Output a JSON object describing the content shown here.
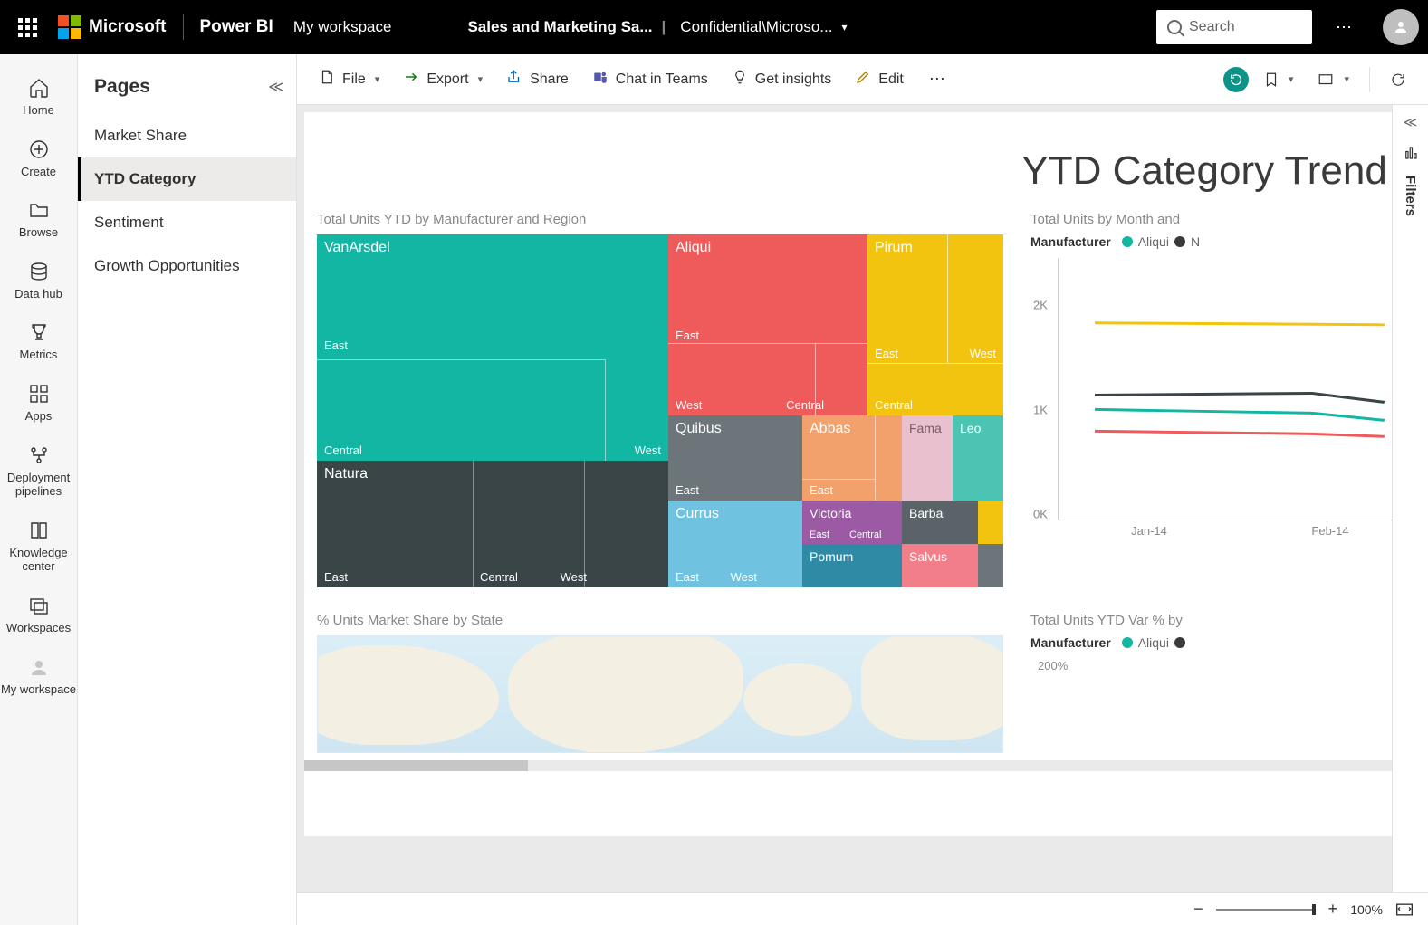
{
  "topbar": {
    "microsoft": "Microsoft",
    "product": "Power BI",
    "workspace": "My workspace",
    "report_name": "Sales and Marketing Sa...",
    "sensitivity": "Confidential\\Microso...",
    "search_placeholder": "Search"
  },
  "rail": {
    "home": "Home",
    "create": "Create",
    "browse": "Browse",
    "datahub": "Data hub",
    "metrics": "Metrics",
    "apps": "Apps",
    "pipelines": "Deployment pipelines",
    "knowledge": "Knowledge center",
    "workspaces": "Workspaces",
    "myworkspace": "My workspace"
  },
  "pages": {
    "header": "Pages",
    "items": [
      "Market Share",
      "YTD Category",
      "Sentiment",
      "Growth Opportunities"
    ],
    "active_index": 1
  },
  "toolbar": {
    "file": "File",
    "export": "Export",
    "share": "Share",
    "teams": "Chat in Teams",
    "insights": "Get insights",
    "edit": "Edit"
  },
  "report": {
    "title": "YTD Category Trend A",
    "treemap_title": "Total Units YTD by Manufacturer and Region",
    "linechart_title": "Total Units by Month and",
    "map_title": "% Units Market Share by State",
    "var_title": "Total Units YTD Var % by",
    "legend_label": "Manufacturer",
    "legend_items": [
      {
        "name": "Aliqui",
        "color": "#13b5a3"
      },
      {
        "name": "N",
        "color": "#3a3a3a"
      }
    ],
    "var_y": "200%"
  },
  "chart_data": {
    "treemap": {
      "type": "treemap",
      "title": "Total Units YTD by Manufacturer and Region",
      "nodes": [
        {
          "mfr": "VanArsdel",
          "color": "#13b5a3",
          "regions": [
            "East",
            "Central",
            "West"
          ]
        },
        {
          "mfr": "Natura",
          "color": "#3a4548",
          "regions": [
            "East",
            "Central",
            "West"
          ]
        },
        {
          "mfr": "Aliqui",
          "color": "#ef5a5a",
          "regions": [
            "East",
            "West",
            "Central"
          ]
        },
        {
          "mfr": "Pirum",
          "color": "#f3c40f",
          "regions": [
            "East",
            "West",
            "Central"
          ]
        },
        {
          "mfr": "Quibus",
          "color": "#6c757a",
          "regions": [
            "East"
          ]
        },
        {
          "mfr": "Abbas",
          "color": "#f2a06c",
          "regions": [
            "East"
          ]
        },
        {
          "mfr": "Fama",
          "color": "#e9c0cd",
          "regions": []
        },
        {
          "mfr": "Leo",
          "color": "#4cc4b3",
          "regions": []
        },
        {
          "mfr": "Currus",
          "color": "#6fc3e0",
          "regions": [
            "East",
            "West"
          ]
        },
        {
          "mfr": "Victoria",
          "color": "#9b5aa3",
          "regions": [
            "East",
            "Central"
          ]
        },
        {
          "mfr": "Barba",
          "color": "#5a6468",
          "regions": []
        },
        {
          "mfr": "Pomum",
          "color": "#2f8aa6",
          "regions": []
        },
        {
          "mfr": "Salvus",
          "color": "#f27e8a",
          "regions": []
        }
      ]
    },
    "linechart": {
      "type": "line",
      "title": "Total Units by Month and Manufacturer",
      "x": [
        "Jan-14",
        "Feb-14"
      ],
      "ylabel": "",
      "yticks": [
        "0K",
        "1K",
        "2K"
      ],
      "ylim": [
        0,
        2200
      ],
      "series": [
        {
          "name": "Pirum",
          "color": "#f3c40f",
          "values": [
            1650,
            1640
          ]
        },
        {
          "name": "Natura",
          "color": "#3a4548",
          "values": [
            1020,
            1040
          ]
        },
        {
          "name": "Aliqui",
          "color": "#13b5a3",
          "values": [
            920,
            870
          ]
        },
        {
          "name": "VanArsdel",
          "color": "#ef5a5a",
          "values": [
            780,
            750
          ]
        }
      ]
    }
  },
  "filters": {
    "label": "Filters"
  },
  "status": {
    "zoom": "100%"
  }
}
